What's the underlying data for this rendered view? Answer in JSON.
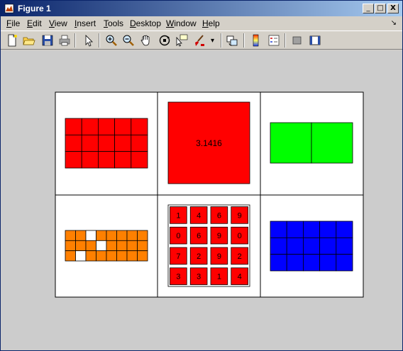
{
  "window": {
    "title": "Figure 1",
    "buttons": {
      "minimize": "_",
      "maximize": "□",
      "close": "X"
    }
  },
  "menubar": {
    "items": [
      {
        "key": "F",
        "rest": "ile"
      },
      {
        "key": "E",
        "rest": "dit"
      },
      {
        "key": "V",
        "rest": "iew"
      },
      {
        "key": "I",
        "rest": "nsert"
      },
      {
        "key": "T",
        "rest": "ools"
      },
      {
        "key": "D",
        "rest": "esktop"
      },
      {
        "key": "W",
        "rest": "indow"
      },
      {
        "key": "H",
        "rest": "elp"
      }
    ],
    "dock_glyph": "↘"
  },
  "toolbar": {
    "tools": [
      "new-figure-icon",
      "open-file-icon",
      "save-icon",
      "print-icon",
      "edit-plot-arrow-icon",
      "zoom-in-icon",
      "zoom-out-icon",
      "pan-hand-icon",
      "rotate-3d-icon",
      "data-cursor-icon",
      "brush-icon",
      "link-plot-icon",
      "colorbar-icon",
      "legend-icon",
      "hide-plot-tools-icon",
      "show-plot-tools-icon"
    ],
    "brush_menu_glyph": "▾"
  },
  "colors": {
    "red": "#ff0000",
    "green": "#00ff00",
    "blue": "#0000ff",
    "orange": "#ff8000",
    "white": "#ffffff",
    "figure_bg": "#cccccc"
  },
  "panels": {
    "scalar_value": "3.1416",
    "magic_matrix": [
      [
        "1",
        "4",
        "6",
        "9"
      ],
      [
        "0",
        "6",
        "9",
        "0"
      ],
      [
        "7",
        "2",
        "9",
        "2"
      ],
      [
        "3",
        "3",
        "1",
        "4"
      ]
    ],
    "orange_blank_cells": [
      [
        0,
        2
      ],
      [
        1,
        3
      ],
      [
        2,
        1
      ]
    ]
  }
}
